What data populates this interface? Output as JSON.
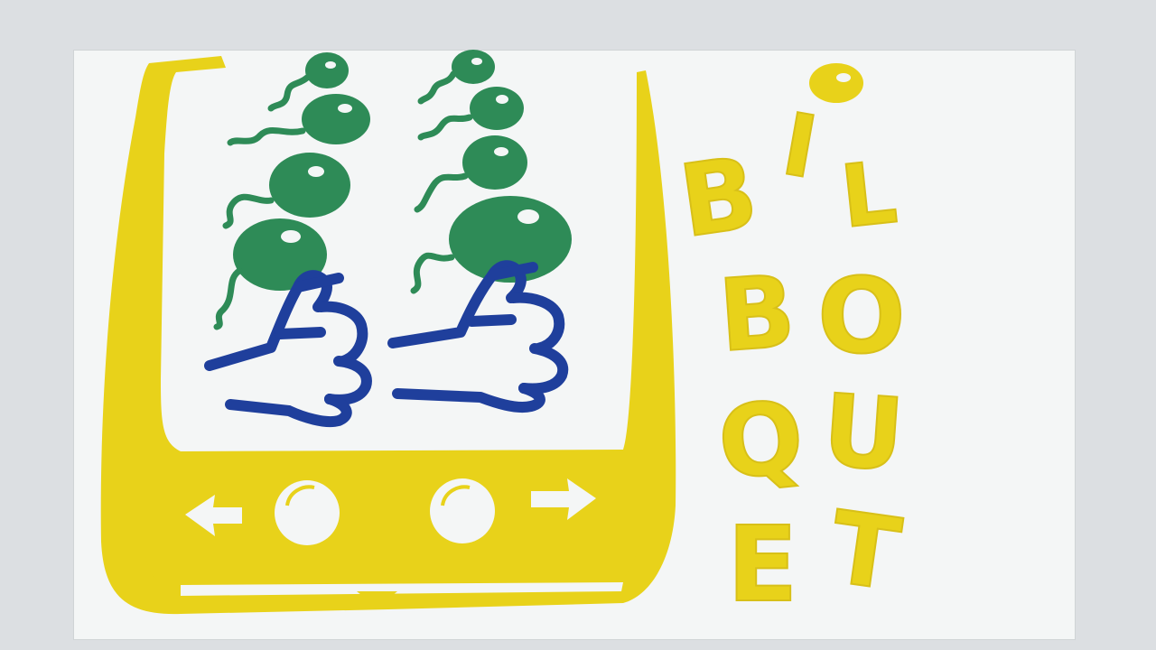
{
  "poster": {
    "title_letters": [
      {
        "char": "B"
      },
      {
        "char": "I"
      },
      {
        "char": "L"
      },
      {
        "char": "B"
      },
      {
        "char": "O"
      },
      {
        "char": "Q"
      },
      {
        "char": "U"
      },
      {
        "char": "E"
      },
      {
        "char": "T"
      }
    ],
    "colors": {
      "background": "#f4f6f6",
      "device": "#e8d21a",
      "balls": "#2e8b57",
      "hands": "#1f3f9c",
      "letters": "#e8d21a"
    },
    "device": {
      "left_arrow_icon": "arrow-left-icon",
      "right_arrow_icon": "arrow-right-icon",
      "left_button": "round-button",
      "right_button": "round-button"
    }
  }
}
